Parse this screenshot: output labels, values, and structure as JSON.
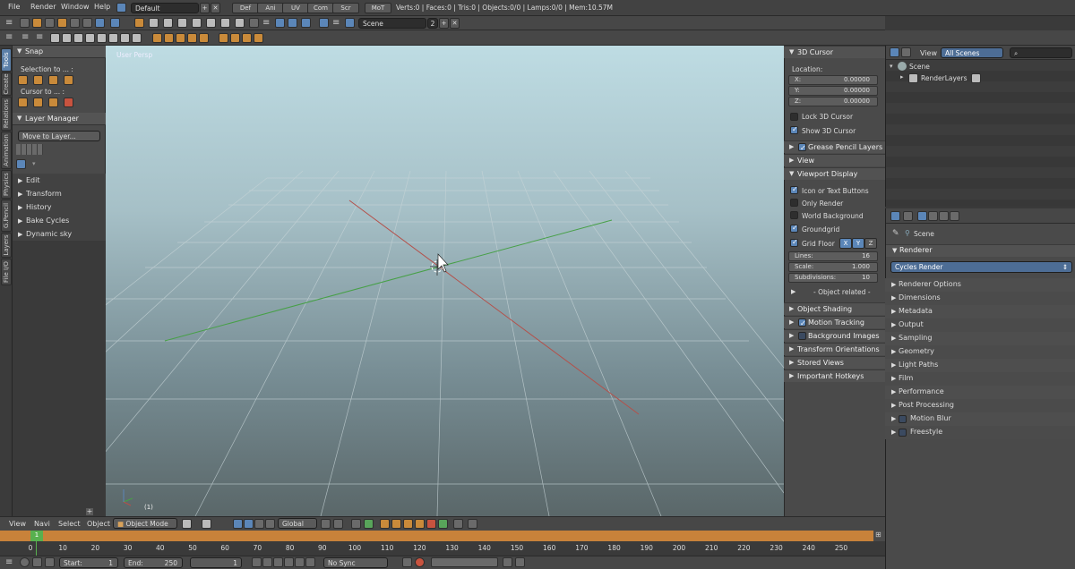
{
  "topbar": {
    "menus": [
      "File",
      "Render",
      "Window",
      "Help"
    ],
    "layout_name": "Default",
    "workspace_tabs": [
      "Def",
      "Ani",
      "UV",
      "Com",
      "Scr",
      "MoT"
    ],
    "scene_name": "Scene",
    "scene_users": "2",
    "stats": "Verts:0 | Faces:0 | Tris:0 | Objects:0/0 | Lamps:0/0 | Mem:10.57M"
  },
  "vtabs": [
    "Tools",
    "Create",
    "Relations",
    "Animation",
    "Physics",
    "G.Pencil",
    "Layers",
    "File I/O"
  ],
  "toolshelf": {
    "snap_header": "Snap",
    "selection_to": "Selection to ... :",
    "cursor_to": "Cursor to ... :",
    "layer_manager_header": "Layer Manager",
    "move_to_layer": "Move to Layer...",
    "collapsed_panels": [
      "Edit",
      "Transform",
      "History",
      "Bake Cycles",
      "Dynamic sky"
    ]
  },
  "viewport": {
    "label": "User Persp",
    "frame_indicator": "(1)"
  },
  "viewport_header": {
    "menus": [
      "View",
      "Navi",
      "Select",
      "Object"
    ],
    "mode": "Object Mode",
    "orientation": "Global"
  },
  "npanel": {
    "cursor_header": "3D Cursor",
    "location_label": "Location:",
    "coords": [
      {
        "axis": "X:",
        "value": "0.00000"
      },
      {
        "axis": "Y:",
        "value": "0.00000"
      },
      {
        "axis": "Z:",
        "value": "0.00000"
      }
    ],
    "lock_cursor": "Lock 3D Cursor",
    "show_cursor": "Show 3D Cursor",
    "grease_pencil_layers": "Grease Pencil Layers",
    "view": "View",
    "viewport_display": "Viewport Display",
    "icon_or_text": "Icon or Text Buttons",
    "only_render": "Only Render",
    "world_background": "World Background",
    "groundgrid": "Groundgrid",
    "grid_floor": "Grid Floor",
    "axes": [
      "X",
      "Y",
      "Z"
    ],
    "lines": {
      "label": "Lines:",
      "value": "16"
    },
    "scale": {
      "label": "Scale:",
      "value": "1.000"
    },
    "subdivisions": {
      "label": "Subdivisions:",
      "value": "10"
    },
    "object_related": "- Object related -",
    "object_shading": "Object Shading",
    "motion_tracking": "Motion Tracking",
    "background_images": "Background Images",
    "transform_orientations": "Transform Orientations",
    "stored_views": "Stored Views",
    "important_hotkeys": "Important Hotkeys"
  },
  "outliner": {
    "view_menu": "View",
    "display_mode": "All Scenes",
    "tree": [
      "Scene",
      "RenderLayers"
    ]
  },
  "properties": {
    "context": "Scene",
    "renderer_header": "Renderer",
    "engine": "Cycles Render",
    "panels": [
      "Renderer Options",
      "Dimensions",
      "Metadata",
      "Output",
      "Sampling",
      "Geometry",
      "Light Paths",
      "Film",
      "Performance",
      "Post Processing",
      "Motion Blur",
      "Freestyle"
    ]
  },
  "timeline": {
    "ticks": [
      "0",
      "10",
      "20",
      "30",
      "40",
      "50",
      "60",
      "70",
      "80",
      "90",
      "100",
      "110",
      "120",
      "130",
      "140",
      "150",
      "160",
      "170",
      "180",
      "190",
      "200",
      "210",
      "220",
      "230",
      "240",
      "250"
    ],
    "current_frame_marker": "1",
    "start_label": "Start:",
    "start_value": "1",
    "end_label": "End:",
    "end_value": "250",
    "current_frame": "1",
    "sync": "No Sync"
  },
  "colors": {
    "x_axis": "#c0504d",
    "y_axis": "#3f9a3f",
    "accent": "#5b86b8",
    "timeline_orange": "#c8823a"
  }
}
